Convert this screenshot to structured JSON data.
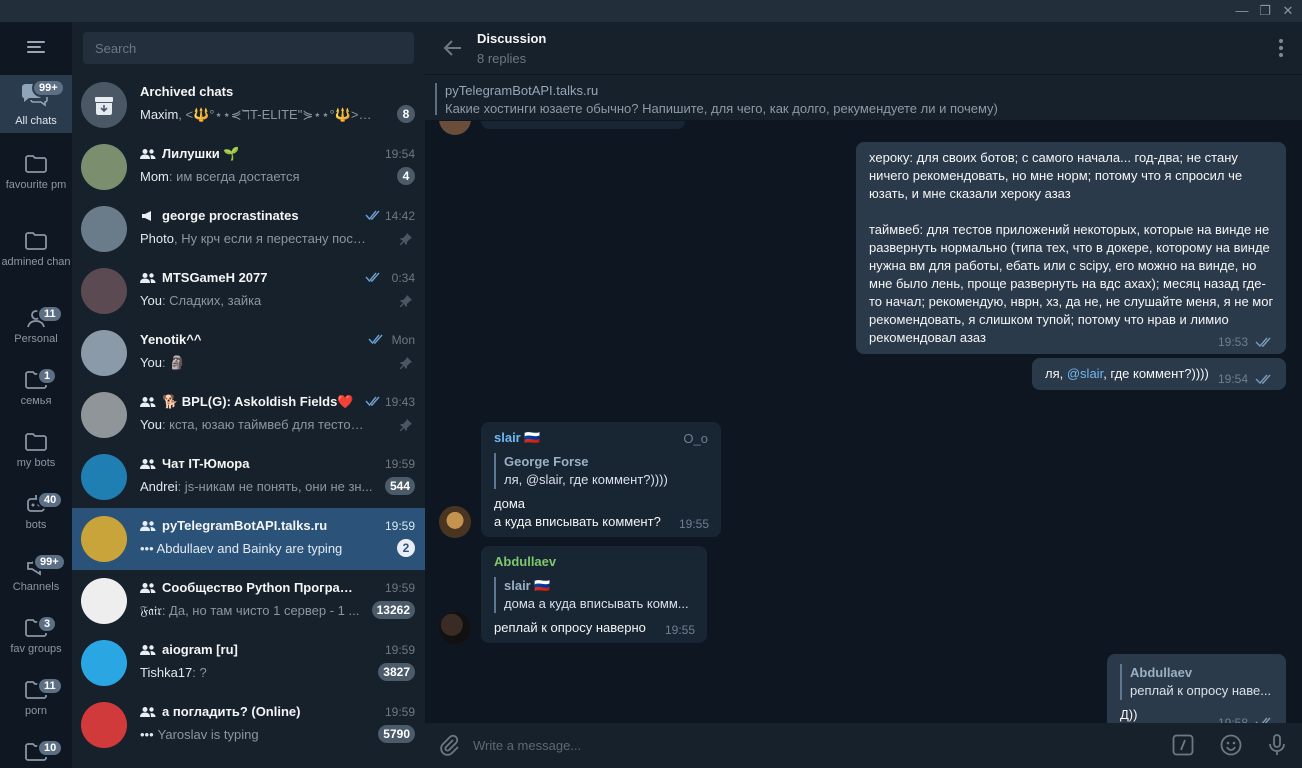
{
  "sidebar": {
    "folders": [
      {
        "label": "All chats",
        "badge": "99+",
        "icon": "chat-bubbles-icon"
      },
      {
        "label": "favourite pm",
        "badge": "",
        "icon": "folder-icon"
      },
      {
        "label": "admined chan",
        "badge": "",
        "icon": "folder-icon"
      },
      {
        "label": "Personal",
        "badge": "11",
        "icon": "person-icon"
      },
      {
        "label": "семья",
        "badge": "1",
        "icon": "folder-icon"
      },
      {
        "label": "my bots",
        "badge": "",
        "icon": "folder-icon"
      },
      {
        "label": "bots",
        "badge": "40",
        "icon": "bot-icon"
      },
      {
        "label": "Channels",
        "badge": "99+",
        "icon": "channel-icon"
      },
      {
        "label": "fav groups",
        "badge": "3",
        "icon": "folder-icon"
      },
      {
        "label": "porn",
        "badge": "11",
        "icon": "folder-icon"
      },
      {
        "label": "",
        "badge": "10",
        "icon": "folder-icon"
      }
    ]
  },
  "search": {
    "placeholder": "Search"
  },
  "chats": [
    {
      "title": "Archived chats",
      "sender": "Maxim",
      "preview": ", <🔱°⋆⋆⋞ℸT-ELITE\"⋟⋆⋆°🔱>⋆⋆⋞",
      "time": "",
      "badge": "8",
      "group": false,
      "channel": false,
      "ticks": false,
      "pinned": false,
      "color": "#4a5866"
    },
    {
      "title": "Лилушки 🌱",
      "sender": "Mom",
      "preview": ": им всегда достается",
      "time": "19:54",
      "badge": "4",
      "group": true,
      "channel": false,
      "ticks": false,
      "pinned": false,
      "color": "#7b8f6f"
    },
    {
      "title": "george procrastinates",
      "sender": "Photo",
      "preview": ", Ну крч если я перестану постит...",
      "time": "14:42",
      "badge": "",
      "group": false,
      "channel": true,
      "ticks": true,
      "pinned": true,
      "color": "#6a7c8a"
    },
    {
      "title": "MTSGameH 2077",
      "sender": "You",
      "preview": ": Сладких, зайка",
      "time": "0:34",
      "badge": "",
      "group": true,
      "channel": false,
      "ticks": true,
      "pinned": true,
      "color": "#5c4a52"
    },
    {
      "title": "Yenotik^^",
      "sender": "You",
      "preview": ": 🗿",
      "time": "Mon",
      "badge": "",
      "group": false,
      "channel": false,
      "ticks": true,
      "pinned": true,
      "color": "#8a9aa8"
    },
    {
      "title": "🐕 BPL(G): Askoldish Fields❤️",
      "sender": "You",
      "preview": ": кста, юзаю таймвеб для тестов. За...",
      "time": "19:43",
      "badge": "",
      "group": true,
      "channel": false,
      "ticks": true,
      "pinned": true,
      "color": "#8f9598"
    },
    {
      "title": "Чат IT-Юмора",
      "sender": "Andrei",
      "preview": ": js-никам не понять, они не зн...",
      "time": "19:59",
      "badge": "544",
      "group": true,
      "channel": false,
      "ticks": false,
      "pinned": false,
      "color": "#1f7fb3"
    },
    {
      "title": "pyTelegramBotAPI.talks.ru",
      "sender": "•••",
      "preview": " Abdullaev and Bainky are typing",
      "time": "19:59",
      "badge": "2",
      "group": true,
      "channel": false,
      "ticks": false,
      "pinned": false,
      "color": "#c9a43a"
    },
    {
      "title": "Сообщество Python Программ...",
      "sender": "𝔉𝔞𝔦𝔯",
      "preview": ": Да, но там чисто 1 сервер - 1 ...",
      "time": "19:59",
      "badge": "13262",
      "group": true,
      "channel": false,
      "ticks": false,
      "pinned": false,
      "color": "#eeeeee"
    },
    {
      "title": "aiogram [ru]",
      "sender": "Tishka17",
      "preview": ": ?",
      "time": "19:59",
      "badge": "3827",
      "group": true,
      "channel": false,
      "ticks": false,
      "pinned": false,
      "color": "#2aa7e3"
    },
    {
      "title": "а погладить? (Online)",
      "sender": "•••",
      "preview": "Yaroslav is typing",
      "time": "19:59",
      "badge": "5790",
      "group": true,
      "channel": false,
      "ticks": false,
      "pinned": false,
      "color": "#d03a3a"
    }
  ],
  "header": {
    "title": "Discussion",
    "subtitle": "8 replies"
  },
  "pinned": {
    "title": "pyTelegramBotAPI.talks.ru",
    "text": "Какие хостинги юзаете обычно? Напишите, для чего, как долго, рекумендуете ли и почему)"
  },
  "messages": {
    "m1": {
      "text": "хероку: для своих ботов; с самого начала... год-два; не стану ничего рекомендовать, но мне норм; потому что я спросил че юзать, и мне сказали хероку азаз\n\nтаймвеб: для тестов приложений некоторых, которые на винде не развернуть нормально (типа тех, что в докере, которому на винде нужна вм для работы, ебать или с scipy, его можно на винде, но мне было лень, проще развернуть на вдс ахах); месяц назад где-то начал; рекомендую, нврн, хз, да не, не слушайте меня, я не мог рекомендовать, я слишком тупой; потому что нрав и лимио рекомендовал азаз",
      "time": "19:53"
    },
    "m2": {
      "prefix": "ля, ",
      "mention": "@slair",
      "suffix": ", где коммент?))))",
      "time": "19:54"
    },
    "m3": {
      "author": "slair 🇷🇺",
      "badge": "O_o",
      "reply_name": "George Forse",
      "reply_text": "ля, @slair, где коммент?))))",
      "text": "дома\nа куда вписывать коммент?",
      "time": "19:55"
    },
    "m4": {
      "author": "Abdullaev",
      "reply_name": "slair 🇷🇺",
      "reply_text": "дома а куда вписывать комм...",
      "text": "реплай к опросу наверно",
      "time": "19:55"
    },
    "m5": {
      "reply_name": "Abdullaev",
      "reply_text": "реплай к опросу наве...",
      "text": "Д))",
      "time": "19:58"
    }
  },
  "composer": {
    "placeholder": "Write a message..."
  },
  "colors": {
    "accent": "#2b5278",
    "green_author": "#7fc76b",
    "blue_author": "#71b7f0",
    "mention": "#71b7f0"
  }
}
